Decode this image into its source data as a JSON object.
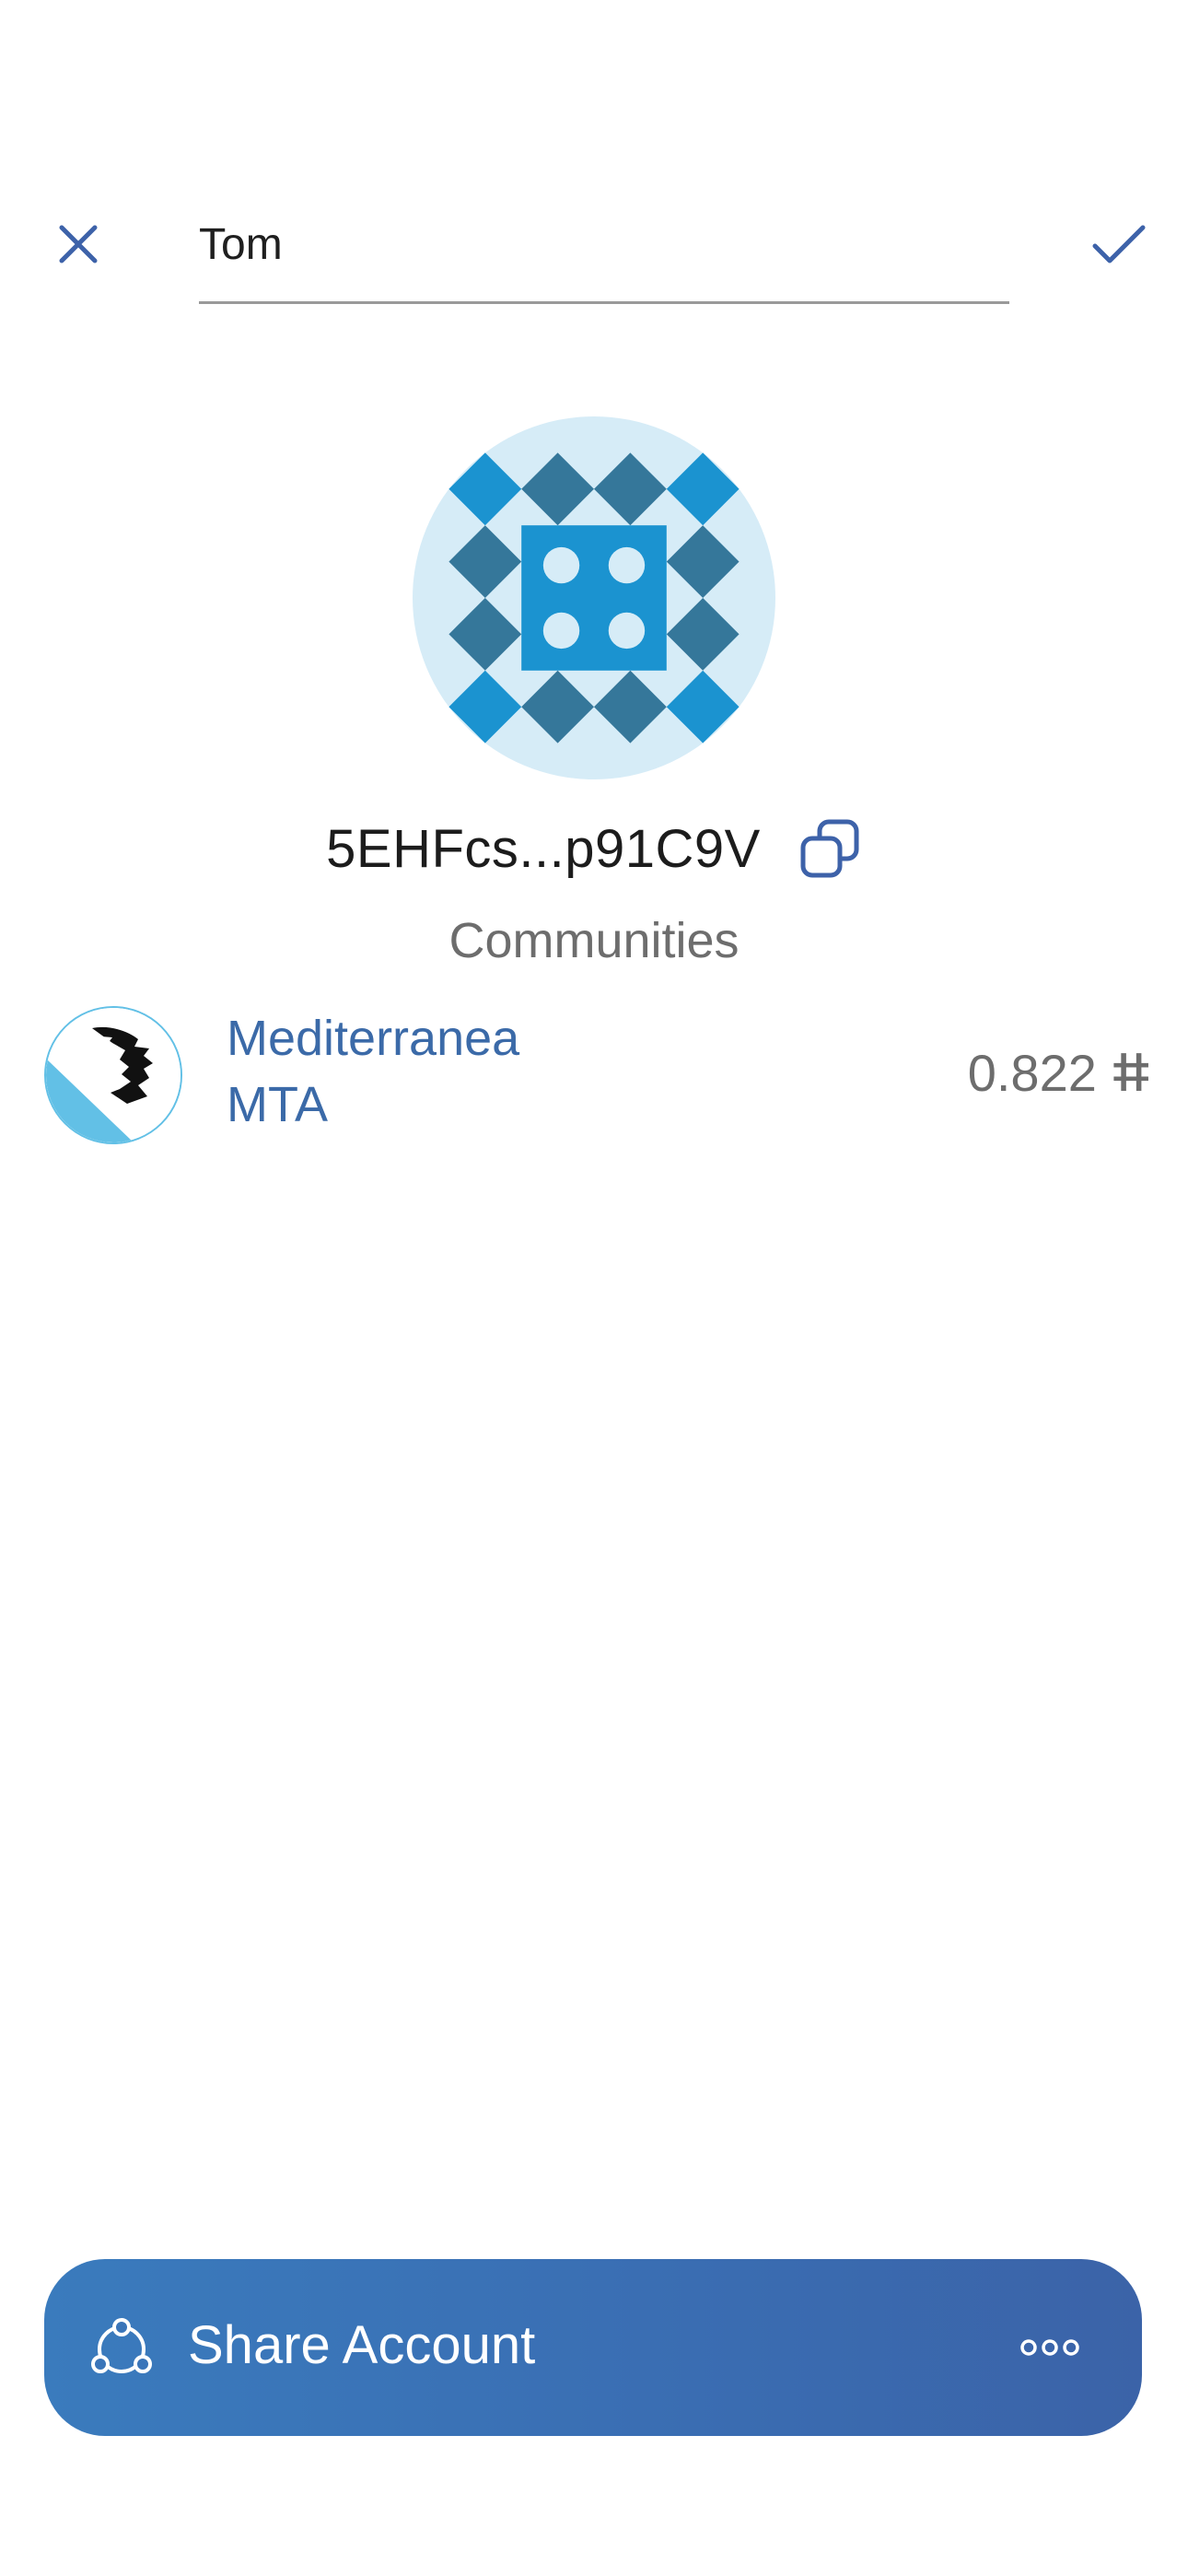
{
  "header": {
    "account_name_value": "Tom",
    "cancel_icon": "close-icon",
    "confirm_icon": "checkmark-icon"
  },
  "account": {
    "address": "5EHFcs...p91C9V",
    "copy_icon": "copy-icon"
  },
  "communities": {
    "title": "Communities",
    "items": [
      {
        "name": "Mediterranea",
        "symbol": "MTA",
        "balance": "0.822 ⵌ"
      }
    ]
  },
  "footer": {
    "share_label": "Share Account",
    "share_icon": "share-icon",
    "more_icon": "more-icon"
  },
  "colors": {
    "accent": "#3b6aa8",
    "identicon_dark": "#35779a",
    "identicon_bright": "#1b93d0",
    "identicon_bg": "#d6ecf7"
  }
}
